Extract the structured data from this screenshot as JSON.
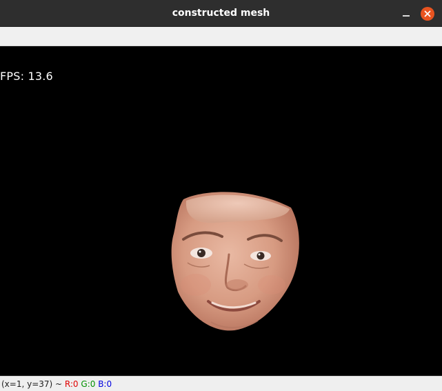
{
  "window": {
    "title": "constructed mesh"
  },
  "overlay": {
    "fps_text": "FPS: 13.6"
  },
  "status": {
    "coords": "(x=1, y=37) ~",
    "r": "R:0",
    "g": "G:0",
    "b": "B:0"
  },
  "colors": {
    "close_button": "#e95420",
    "r_text": "#e00000",
    "g_text": "#009000",
    "b_text": "#0000e0"
  },
  "icons": {
    "minimize": "minimize-icon",
    "close": "close-icon"
  }
}
